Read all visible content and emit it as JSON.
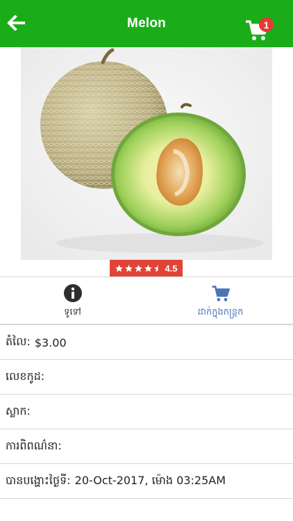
{
  "header": {
    "title": "Melon",
    "cart_count": "1"
  },
  "product": {
    "rating": "4.5",
    "rating_stars": 4.5
  },
  "actions": {
    "info_label": "ទូទៅ",
    "add_to_cart_label": "ដាក់ក្នុងកន្ត្រក"
  },
  "details": {
    "price_label": "តំលៃ:",
    "price_value": "$3.00",
    "code_label": "លេខកូដ:",
    "brand_label": "ស្លាក:",
    "description_label": "ការពិពណ៌នា:",
    "posted_label": "បានបង្ហោះថ្ងៃទី:",
    "posted_value": "20-Oct-2017, ម៉ោង 03:25AM"
  },
  "colors": {
    "header_bg": "#1aad19",
    "badge_bg": "#e53935",
    "rating_bg": "#e04437",
    "cart_action": "#4a74b5"
  }
}
